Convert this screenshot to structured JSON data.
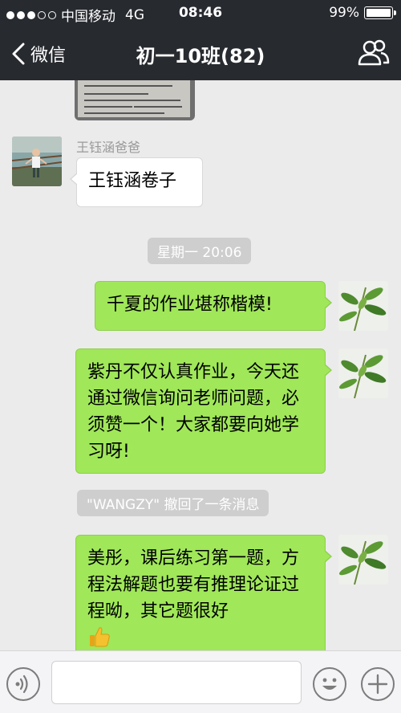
{
  "status_bar": {
    "carrier": "中国移动",
    "network": "4G",
    "time": "08:46",
    "battery": "99%",
    "battery_level": 0.99,
    "signal_bars": 3,
    "signal_total": 5
  },
  "nav": {
    "back_label": "微信",
    "title": "初一10班(82)"
  },
  "messages": {
    "msg1": {
      "sender": "王钰涵爸爸",
      "text": "王钰涵卷子"
    },
    "timestamp": "星期一 20:06",
    "msg2": {
      "text": "千夏的作业堪称楷模!"
    },
    "msg3": {
      "text": "紫丹不仅认真作业，今天还通过微信询问老师问题，必须赞一个！大家都要向她学习呀!"
    },
    "recall": "\"WANGZY\" 撤回了一条消息",
    "msg4": {
      "text": "美彤，课后练习第一题，方程法解题也要有推理论证过程呦，其它题很好"
    }
  },
  "input_bar": {
    "placeholder": ""
  }
}
